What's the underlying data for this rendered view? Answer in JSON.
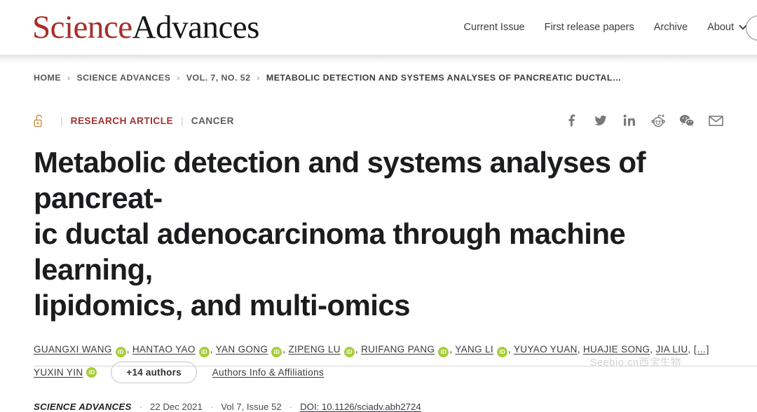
{
  "header": {
    "brand_part1": "Science",
    "brand_part2": "Advances",
    "nav": [
      {
        "label": "Current Issue"
      },
      {
        "label": "First release papers"
      },
      {
        "label": "Archive"
      }
    ],
    "about_label": "About",
    "account_icon": "account-circle-icon",
    "chevron_icon": "chevron-down-icon"
  },
  "breadcrumb": {
    "separator": "›",
    "items": [
      {
        "label": "HOME"
      },
      {
        "label": "SCIENCE ADVANCES"
      },
      {
        "label": "VOL. 7, NO. 52"
      },
      {
        "label": "METABOLIC DETECTION AND SYSTEMS ANALYSES OF PANCREATIC DUCTAL…"
      }
    ]
  },
  "article": {
    "open_access_icon": "open-padlock-icon",
    "divider": "|",
    "type": "RESEARCH ARTICLE",
    "topic": "CANCER",
    "title": "Metabolic detection and systems analyses of pancreatic ductal adenocarcinoma through machine learning, lipidomics, and multi-omics",
    "title_lines": [
      "Metabolic detection and systems analyses of pancreat-",
      "ic ductal adenocarcinoma through machine learning,",
      "lipidomics, and multi-omics"
    ],
    "social": [
      {
        "name": "facebook-icon"
      },
      {
        "name": "twitter-icon"
      },
      {
        "name": "linkedin-icon"
      },
      {
        "name": "reddit-icon"
      },
      {
        "name": "wechat-icon"
      },
      {
        "name": "email-icon"
      }
    ],
    "orcid_badge_label": "iD",
    "orcid_badge_color": "#a6ce39",
    "authors": [
      {
        "name": "GUANGXI WANG",
        "orcid": true
      },
      {
        "name": "HANTAO YAO",
        "orcid": true
      },
      {
        "name": "YAN GONG",
        "orcid": true
      },
      {
        "name": "ZIPENG LU",
        "orcid": true
      },
      {
        "name": "RUIFANG PANG",
        "orcid": true
      },
      {
        "name": "YANG LI",
        "orcid": true
      },
      {
        "name": "YUYAO YUAN",
        "orcid": false
      },
      {
        "name": "HUAJIE SONG",
        "orcid": false
      },
      {
        "name": "JIA LIU",
        "orcid": false
      }
    ],
    "authors_truncation": "[…]",
    "last_author": {
      "name": "YUXIN YIN",
      "orcid": true
    },
    "more_authors_label": "+14 authors",
    "affiliations_label": "Authors Info & Affiliations",
    "citation": {
      "journal": "SCIENCE ADVANCES",
      "date": "22 Dec 2021",
      "volume_issue": "Vol 7, Issue 52",
      "doi": "DOI: 10.1126/sciadv.abh2724",
      "dot": "·"
    }
  },
  "watermark": {
    "text": "Seebio.cn西宝生物"
  }
}
